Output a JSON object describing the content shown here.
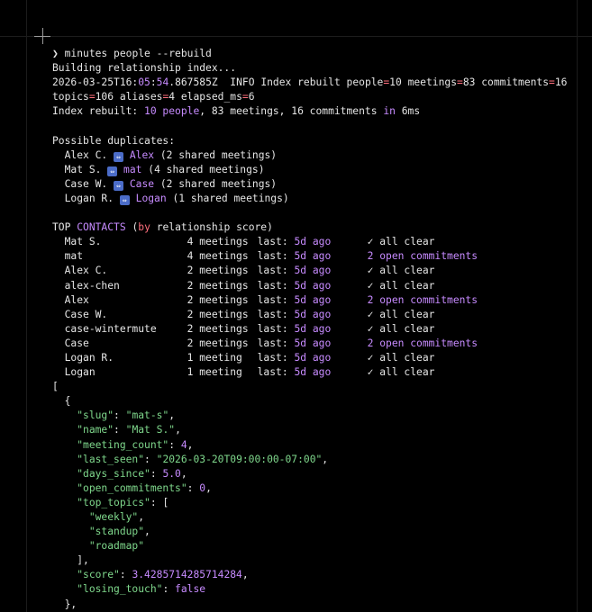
{
  "prompt": "❯",
  "command": "minutes people --rebuild",
  "building": "Building relationship index...",
  "log": {
    "date": "2026-03-25T16",
    "time_min": "05",
    "time_sec": "54",
    "frac": ".867585Z",
    "level": "INFO",
    "msg": "Index rebuilt people",
    "people": "10",
    "meetings": "83",
    "commitments": "16",
    "topics": "106",
    "aliases": "4",
    "elapsed_ms": "6"
  },
  "summary": {
    "prefix": "Index rebuilt:",
    "people": "10 people",
    "rest": "83 meetings, 16 commitments",
    "in": "in",
    "time": "6ms"
  },
  "duplicates": {
    "title": "Possible duplicates:",
    "items": [
      {
        "a": "Alex C.",
        "b": "Alex",
        "note": "(2 shared meetings)"
      },
      {
        "a": "Mat S.",
        "b": "mat",
        "note": "(4 shared meetings)"
      },
      {
        "a": "Case W.",
        "b": "Case",
        "note": "(2 shared meetings)"
      },
      {
        "a": "Logan R.",
        "b": "Logan",
        "note": "(1 shared meetings)"
      }
    ]
  },
  "top": {
    "t1": "TOP",
    "t2": "CONTACTS",
    "t3": "(",
    "t4": "by",
    "t5": "relationship score)",
    "rows": [
      {
        "name": "Mat S.",
        "meet": "4 meetings",
        "last_label": "last:",
        "ago": "5d ago",
        "status": "✓ all clear",
        "open": false
      },
      {
        "name": "mat",
        "meet": "4 meetings",
        "last_label": "last:",
        "ago": "5d ago",
        "status": "2 open commitments",
        "open": true
      },
      {
        "name": "Alex C.",
        "meet": "2 meetings",
        "last_label": "last:",
        "ago": "5d ago",
        "status": "✓ all clear",
        "open": false
      },
      {
        "name": "alex-chen",
        "meet": "2 meetings",
        "last_label": "last:",
        "ago": "5d ago",
        "status": "✓ all clear",
        "open": false
      },
      {
        "name": "Alex",
        "meet": "2 meetings",
        "last_label": "last:",
        "ago": "5d ago",
        "status": "2 open commitments",
        "open": true
      },
      {
        "name": "Case W.",
        "meet": "2 meetings",
        "last_label": "last:",
        "ago": "5d ago",
        "status": "✓ all clear",
        "open": false
      },
      {
        "name": "case-wintermute",
        "meet": "2 meetings",
        "last_label": "last:",
        "ago": "5d ago",
        "status": "✓ all clear",
        "open": false
      },
      {
        "name": "Case",
        "meet": "2 meetings",
        "last_label": "last:",
        "ago": "5d ago",
        "status": "2 open commitments",
        "open": true
      },
      {
        "name": "Logan R.",
        "meet": "1 meeting",
        "last_label": "last:",
        "ago": "5d ago",
        "status": "✓ all clear",
        "open": false
      },
      {
        "name": "Logan",
        "meet": "1 meeting",
        "last_label": "last:",
        "ago": "5d ago",
        "status": "✓ all clear",
        "open": false
      }
    ]
  },
  "json": {
    "open_bracket": "[",
    "open_brace": "{",
    "slug_k": "\"slug\"",
    "slug_v": "\"mat-s\"",
    "name_k": "\"name\"",
    "name_v": "\"Mat S.\"",
    "mc_k": "\"meeting_count\"",
    "mc_v": "4",
    "ls_k": "\"last_seen\"",
    "ls_v": "\"2026-03-20T09:00:00-07:00\"",
    "ds_k": "\"days_since\"",
    "ds_v": "5.0",
    "oc_k": "\"open_commitments\"",
    "oc_v": "0",
    "tt_k": "\"top_topics\"",
    "tt_open": "[",
    "topics": [
      "\"weekly\"",
      "\"standup\"",
      "\"roadmap\""
    ],
    "tt_close": "],",
    "score_k": "\"score\"",
    "score_v": "3.4285714285714284",
    "lt_k": "\"losing_touch\"",
    "lt_v": "false",
    "close_brace": "},"
  }
}
